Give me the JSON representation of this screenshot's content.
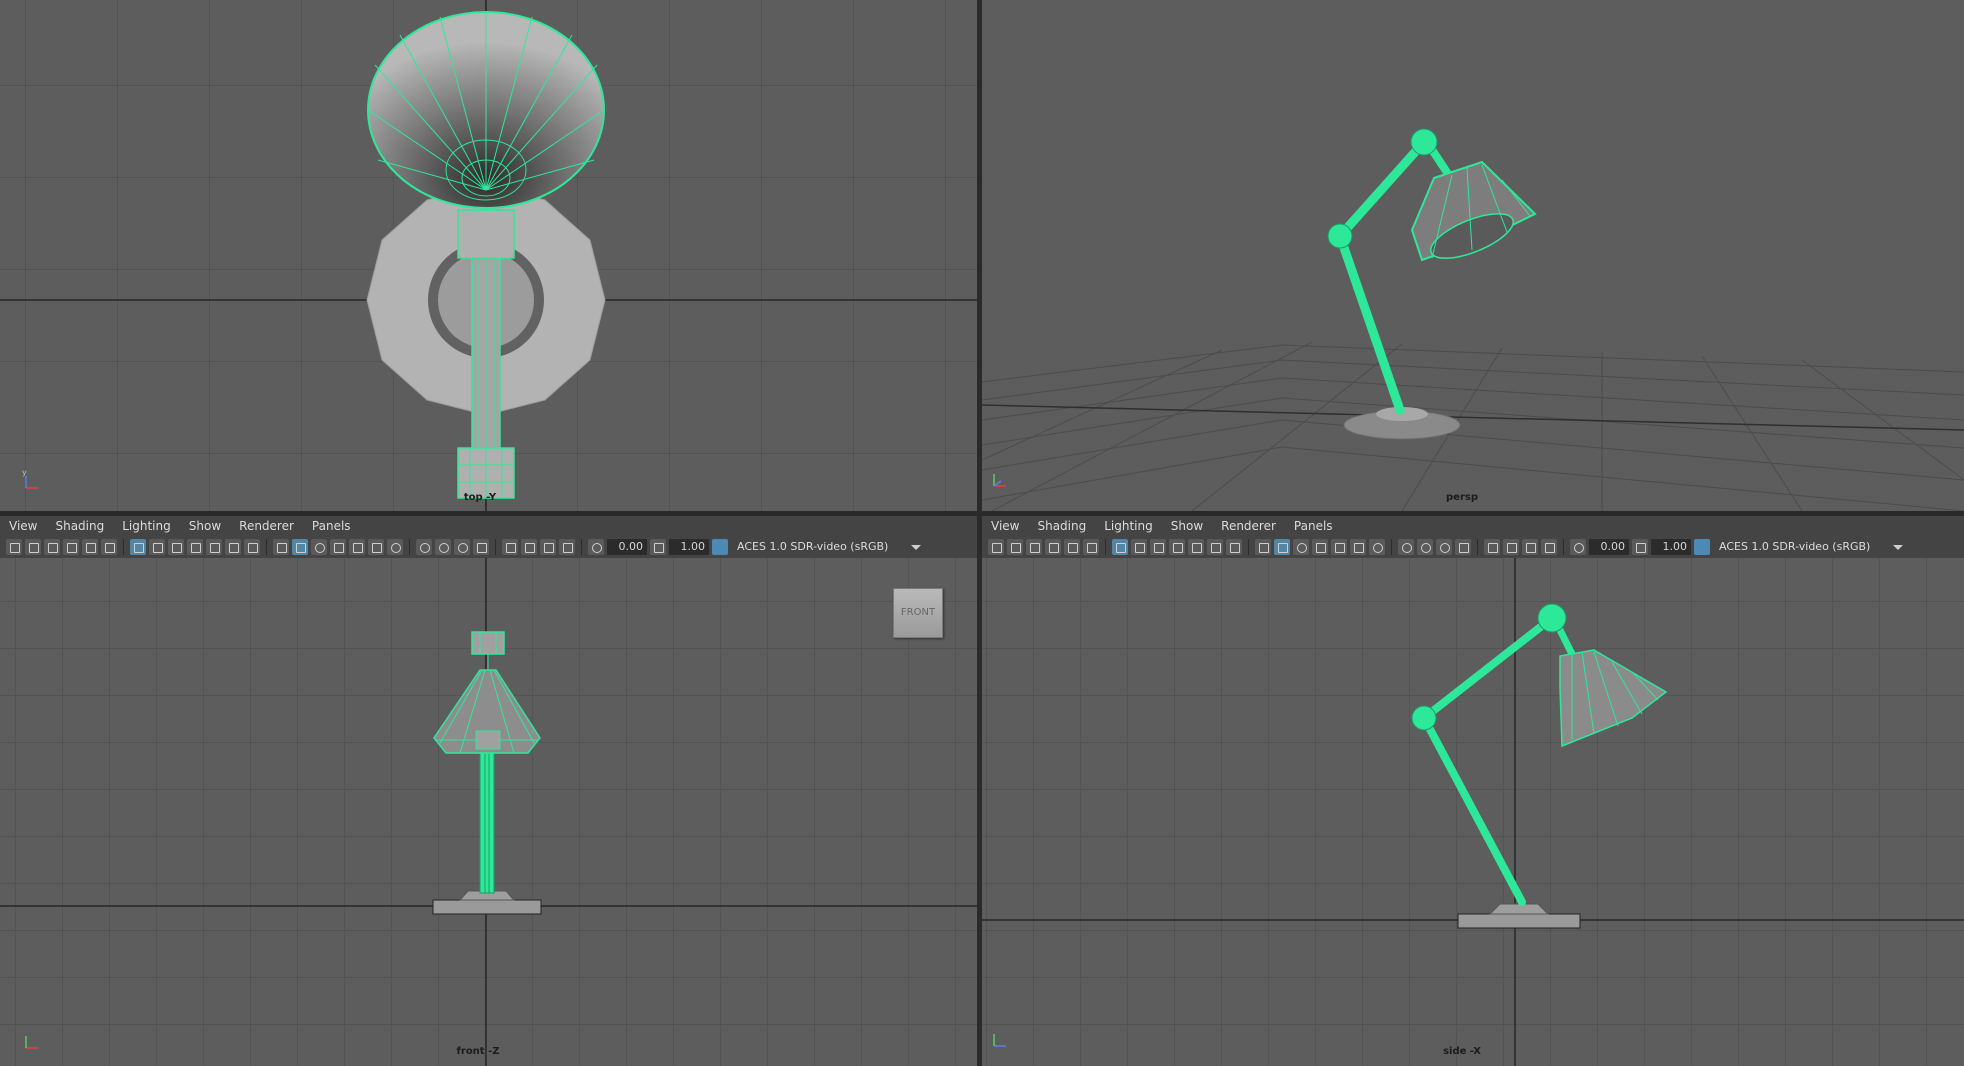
{
  "menus": [
    "View",
    "Shading",
    "Lighting",
    "Show",
    "Renderer",
    "Panels"
  ],
  "toolbar": {
    "exposure": "0.00",
    "gamma": "1.00",
    "color_management": "ACES 1.0 SDR-video (sRGB)"
  },
  "viewports": {
    "top": {
      "label": "top -Y"
    },
    "persp": {
      "label": "persp"
    },
    "front": {
      "label": "front -Z",
      "viewcube": "FRONT"
    },
    "side": {
      "label": "side -X"
    }
  },
  "colors": {
    "viewport_bg": "#5d5d5d",
    "grid": "#4a4a4a",
    "axis": "#262626",
    "wireframe": "#2ee89a",
    "mesh_fill": "#8c8c8c"
  }
}
